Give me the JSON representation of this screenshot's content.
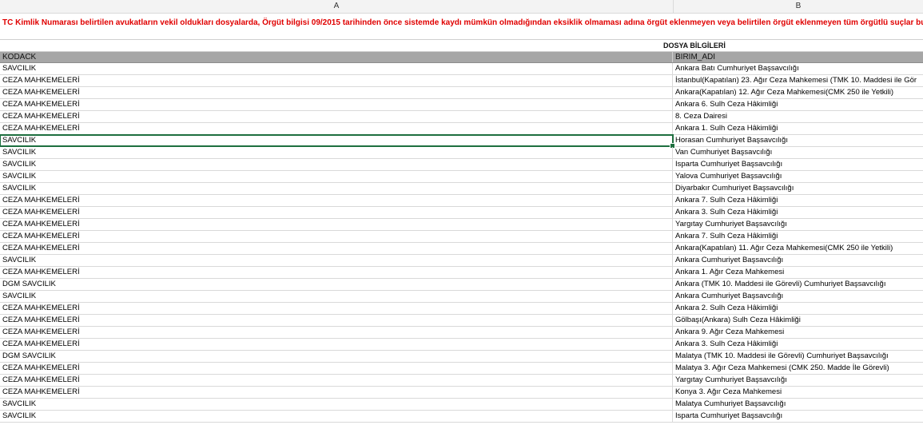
{
  "columns": {
    "a": "A",
    "b": "B"
  },
  "banner": "TC Kimlik Numarası belirtilen avukatların vekil oldukları dosyalarda, Örgüt bilgisi 09/2015 tarihinden önce sistemde kaydı mümkün olmadığından eksiklik olmaması adına örgüt eklenmeyen veya belirtilen örgüt eklenmeyen tüm örgütlü suçlar bu listede y",
  "section_title": "DOSYA BİLGİLERİ",
  "header": {
    "a": "KODACK",
    "b": "BIRIM_ADI"
  },
  "selected_row_index": 6,
  "rows": [
    {
      "a": "SAVCILIK",
      "b": "Ankara Batı Cumhuriyet Başsavcılığı"
    },
    {
      "a": "CEZA MAHKEMELERİ",
      "b": "İstanbul(Kapatılan) 23. Ağır Ceza Mahkemesi (TMK 10. Maddesi ile Gör"
    },
    {
      "a": "CEZA MAHKEMELERİ",
      "b": "Ankara(Kapatılan) 12. Ağır Ceza Mahkemesi(CMK 250 ile Yetkili)"
    },
    {
      "a": "CEZA MAHKEMELERİ",
      "b": "Ankara 6. Sulh Ceza Hâkimliği"
    },
    {
      "a": "CEZA MAHKEMELERİ",
      "b": "8. Ceza Dairesi"
    },
    {
      "a": "CEZA MAHKEMELERİ",
      "b": "Ankara 1. Sulh Ceza Hâkimliği"
    },
    {
      "a": "SAVCILIK",
      "b": "Horasan Cumhuriyet Başsavcılığı"
    },
    {
      "a": "SAVCILIK",
      "b": "Van Cumhuriyet Başsavcılığı"
    },
    {
      "a": "SAVCILIK",
      "b": "Isparta Cumhuriyet Başsavcılığı"
    },
    {
      "a": "SAVCILIK",
      "b": "Yalova Cumhuriyet Başsavcılığı"
    },
    {
      "a": "SAVCILIK",
      "b": "Diyarbakır Cumhuriyet Başsavcılığı"
    },
    {
      "a": "CEZA MAHKEMELERİ",
      "b": "Ankara 7. Sulh Ceza Hâkimliği"
    },
    {
      "a": "CEZA MAHKEMELERİ",
      "b": "Ankara 3. Sulh Ceza Hâkimliği"
    },
    {
      "a": "CEZA MAHKEMELERİ",
      "b": "Yargıtay Cumhuriyet Başsavcılığı"
    },
    {
      "a": "CEZA MAHKEMELERİ",
      "b": "Ankara 7. Sulh Ceza Hâkimliği"
    },
    {
      "a": "CEZA MAHKEMELERİ",
      "b": "Ankara(Kapatılan) 11. Ağır Ceza Mahkemesi(CMK 250 ile Yetkili)"
    },
    {
      "a": "SAVCILIK",
      "b": "Ankara Cumhuriyet Başsavcılığı"
    },
    {
      "a": "CEZA MAHKEMELERİ",
      "b": "Ankara 1. Ağır Ceza Mahkemesi"
    },
    {
      "a": "DGM SAVCILIK",
      "b": "Ankara (TMK 10. Maddesi ile Görevli) Cumhuriyet Başsavcılığı"
    },
    {
      "a": "SAVCILIK",
      "b": "Ankara Cumhuriyet Başsavcılığı"
    },
    {
      "a": "CEZA MAHKEMELERİ",
      "b": "Ankara 2. Sulh Ceza Hâkimliği"
    },
    {
      "a": "CEZA MAHKEMELERİ",
      "b": "Gölbaşı(Ankara) Sulh Ceza Hâkimliği"
    },
    {
      "a": "CEZA MAHKEMELERİ",
      "b": "Ankara 9. Ağır Ceza Mahkemesi"
    },
    {
      "a": "CEZA MAHKEMELERİ",
      "b": "Ankara 3. Sulh Ceza Hâkimliği"
    },
    {
      "a": "DGM SAVCILIK",
      "b": "Malatya (TMK 10. Maddesi ile Görevli) Cumhuriyet Başsavcılığı"
    },
    {
      "a": "CEZA MAHKEMELERİ",
      "b": "Malatya 3. Ağır Ceza Mahkemesi (CMK 250. Madde İle Görevli)"
    },
    {
      "a": "CEZA MAHKEMELERİ",
      "b": "Yargıtay Cumhuriyet Başsavcılığı"
    },
    {
      "a": "CEZA MAHKEMELERİ",
      "b": "Konya 3. Ağır Ceza Mahkemesi"
    },
    {
      "a": "SAVCILIK",
      "b": "Malatya Cumhuriyet Başsavcılığı"
    },
    {
      "a": "SAVCILIK",
      "b": "Isparta Cumhuriyet Başsavcılığı"
    }
  ]
}
